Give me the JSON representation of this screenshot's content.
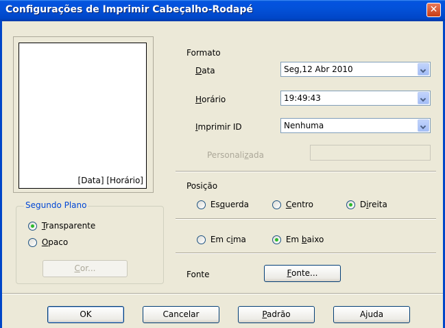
{
  "window": {
    "title": "Configurações de Imprimir Cabeçalho-Rodapé",
    "close_glyph": "✕"
  },
  "preview": {
    "text": "[Data] [Horário]"
  },
  "background_group": {
    "title": "Segundo Plano",
    "transparent": {
      "prefix": "",
      "mnemonic": "T",
      "rest": "ransparente"
    },
    "opaque": {
      "prefix": "",
      "mnemonic": "O",
      "rest": "paco"
    },
    "color_button": {
      "prefix": "",
      "mnemonic": "C",
      "rest": "or..."
    }
  },
  "format": {
    "title": "Formato",
    "date": {
      "label_mn": "D",
      "label_rest": "ata",
      "value": "Seg,12 Abr 2010"
    },
    "time": {
      "label_mn": "H",
      "label_rest": "orário",
      "value": "19:49:43"
    },
    "print_id": {
      "label_mn": "I",
      "label_rest": "mprimir ID",
      "value": "Nenhuma"
    },
    "custom": {
      "label_pre": "Personali",
      "label_mn": "z",
      "label_rest": "ada",
      "value": ""
    }
  },
  "position": {
    "title": "Posição",
    "left": {
      "pre": "Es",
      "mn": "q",
      "rest": "uerda"
    },
    "center": {
      "pre": "",
      "mn": "C",
      "rest": "entro"
    },
    "right": {
      "pre": "D",
      "mn": "i",
      "rest": "reita"
    },
    "top": {
      "pre": "Em c",
      "mn": "i",
      "rest": "ma"
    },
    "bottom": {
      "pre": "Em ",
      "mn": "b",
      "rest": "aixo"
    }
  },
  "font": {
    "label": "Fonte",
    "button": {
      "mn": "F",
      "rest": "onte..."
    }
  },
  "buttons": {
    "ok": "OK",
    "cancel": "Cancelar",
    "default": {
      "mn": "P",
      "rest": "adrão"
    },
    "help": "Ajuda"
  }
}
